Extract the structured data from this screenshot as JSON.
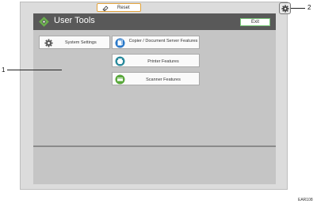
{
  "reset": {
    "label": "Reset",
    "icon": "eraser-icon"
  },
  "window": {
    "title": "User Tools",
    "exit_label": "Exit"
  },
  "buttons": {
    "system_settings": "System Settings",
    "copier": "Copier / Document Server Features",
    "printer": "Printer Features",
    "scanner": "Scanner Features"
  },
  "callouts": [
    "1",
    "2"
  ],
  "figure_code": "EAR108",
  "colors": {
    "titlebar": "#595959",
    "screen": "#c5c5c5",
    "reset_border": "#e2a23a",
    "exit_border": "#79c979",
    "feature_icon": "#2a78c8",
    "scanner_icon": "#5aa83c"
  }
}
